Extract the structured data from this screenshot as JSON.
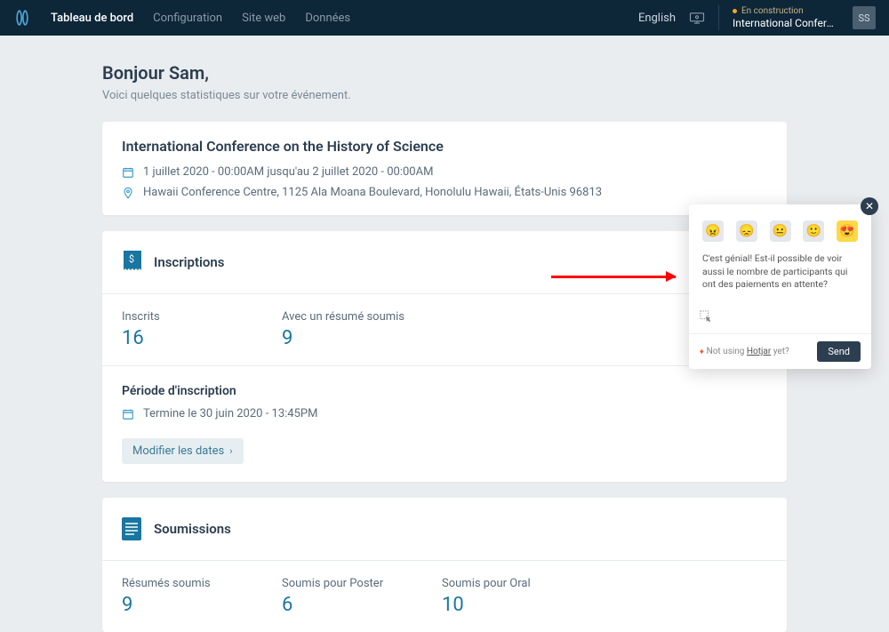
{
  "nav": {
    "items": [
      "Tableau de bord",
      "Configuration",
      "Site web",
      "Données"
    ],
    "lang": "English",
    "status": "En construction",
    "event": "International Conference…",
    "userInitials": "SS"
  },
  "greeting": "Bonjour Sam,",
  "subtitle": "Voici quelques statistiques sur votre événement.",
  "event": {
    "title": "International Conference on the History of Science",
    "dates": "1 juillet 2020 - 00:00AM jusqu'au 2 juillet 2020 - 00:00AM",
    "location": "Hawaii Conference Centre, 1125 Ala Moana Boulevard, Honolulu Hawaii, États-Unis 96813"
  },
  "inscriptions": {
    "title": "Inscriptions",
    "stats": [
      {
        "label": "Inscrits",
        "value": "16"
      },
      {
        "label": "Avec un résumé soumis",
        "value": "9"
      }
    ],
    "period": {
      "title": "Période d'inscription",
      "text": "Termine le 30 juin 2020 - 13:45PM",
      "button": "Modifier les dates"
    }
  },
  "soumissions": {
    "title": "Soumissions",
    "stats": [
      {
        "label": "Résumés soumis",
        "value": "9"
      },
      {
        "label": "Soumis pour Poster",
        "value": "6"
      },
      {
        "label": "Soumis pour Oral",
        "value": "10"
      }
    ]
  },
  "feedback": {
    "text": "C'est génial! Est-il possible de voir aussi le nombre de participants qui ont des paiements en attente?",
    "brandPrefix": "Not using ",
    "brandLink": "Hotjar",
    "brandSuffix": " yet?",
    "send": "Send"
  }
}
